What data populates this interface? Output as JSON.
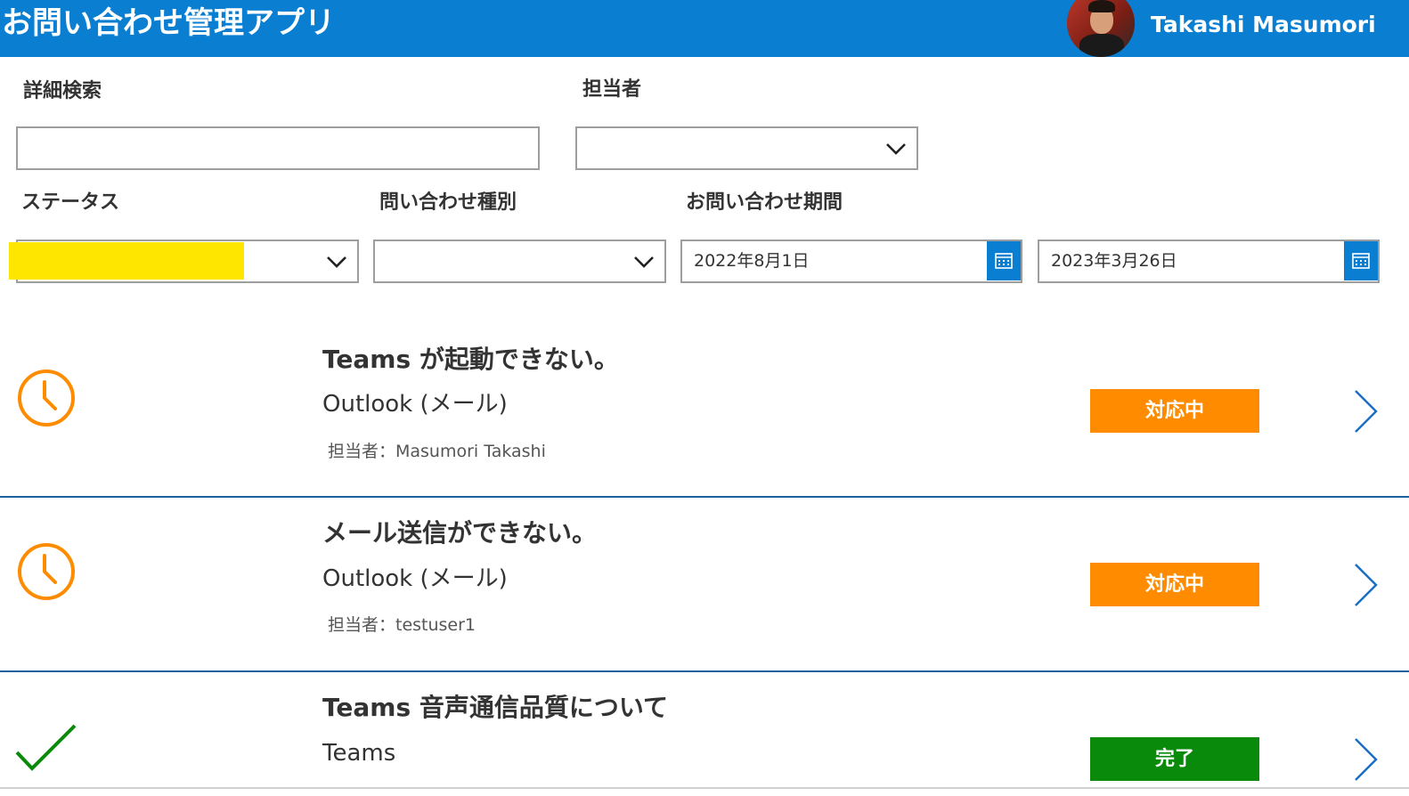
{
  "header": {
    "app_title": "お問い合わせ管理アプリ",
    "user_name": "Takashi Masumori"
  },
  "filters": {
    "search_label": "詳細検索",
    "search_value": "",
    "owner_label": "担当者",
    "owner_value": "",
    "status_label": "ステータス",
    "status_value": "",
    "category_label": "問い合わせ種別",
    "category_value": "",
    "period_label": "お問い合わせ期間",
    "date_from": "2022年8月1日",
    "date_to": "2023年3月26日"
  },
  "items": [
    {
      "title": "Teams が起動できない。",
      "category": "Outlook (メール)",
      "owner": "担当者：Masumori Takashi",
      "status": "対応中",
      "icon": "clock-icon"
    },
    {
      "title": "メール送信ができない。",
      "category": "Outlook (メール)",
      "owner": "担当者：testuser1",
      "status": "対応中",
      "icon": "clock-icon"
    },
    {
      "title": "Teams 音声通信品質について",
      "category": "Teams",
      "owner": "",
      "status": "完了",
      "icon": "checkmark-icon"
    }
  ],
  "colors": {
    "header_bg": "#0a7fd2",
    "status_in_progress": "#ff8c00",
    "status_done": "#0a8a0a",
    "highlight": "#ffe600",
    "divider": "#1c5f9e"
  }
}
